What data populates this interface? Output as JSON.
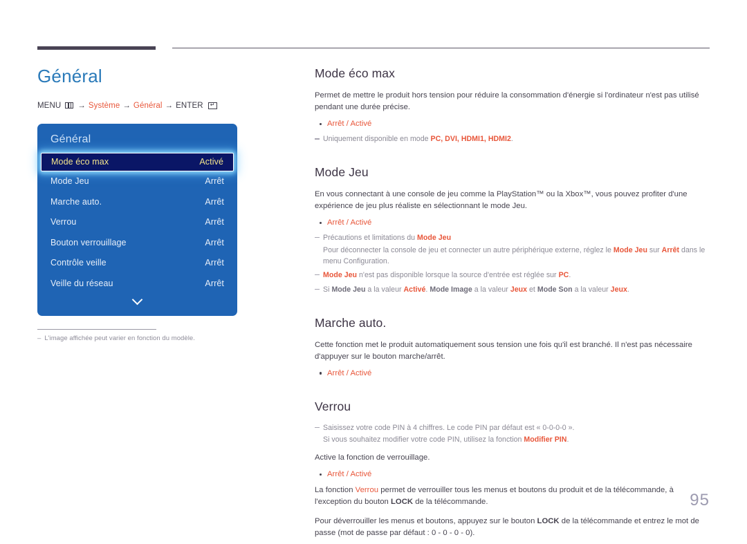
{
  "page": {
    "title": "Général",
    "number": "95",
    "accent_color": "#e8563a",
    "title_color": "#2a7ab9",
    "osd_color": "#1f64b4"
  },
  "breadcrumb": {
    "menu_label": "MENU",
    "menu_icon": "menu-grid-icon",
    "arrow": "→",
    "item1": "Système",
    "item2": "Général",
    "enter_label": "ENTER",
    "enter_icon": "enter-key-icon"
  },
  "osd": {
    "header": "Général",
    "more_icon": "chevron-down-icon",
    "rows": [
      {
        "label": "Mode éco max",
        "value": "Activé",
        "selected": true
      },
      {
        "label": "Mode Jeu",
        "value": "Arrêt",
        "selected": false
      },
      {
        "label": "Marche auto.",
        "value": "Arrêt",
        "selected": false
      },
      {
        "label": "Verrou",
        "value": "Arrêt",
        "selected": false
      },
      {
        "label": "Bouton verrouillage",
        "value": "Arrêt",
        "selected": false
      },
      {
        "label": "Contrôle veille",
        "value": "Arrêt",
        "selected": false
      },
      {
        "label": "Veille du réseau",
        "value": "Arrêt",
        "selected": false
      }
    ]
  },
  "left_note": {
    "dash": "–",
    "text": "L'image affichée peut varier en fonction du modèle."
  },
  "sections": {
    "eco": {
      "title": "Mode éco max",
      "para": "Permet de mettre le produit hors tension pour réduire la consommation d'énergie si l'ordinateur n'est pas utilisé pendant une durée précise.",
      "bullet_off": "Arrêt",
      "bullet_sep": " / ",
      "bullet_on": "Activé",
      "note_prefix": "Uniquement disponible en mode ",
      "note_modes": "PC, DVI, HDMI1, HDMI2",
      "note_suffix": "."
    },
    "jeu": {
      "title": "Mode Jeu",
      "para": "En vous connectant à une console de jeu comme la PlayStation™ ou la Xbox™, vous pouvez profiter d'une expérience de jeu plus réaliste en sélectionnant le mode Jeu.",
      "bullet_off": "Arrêt",
      "bullet_sep": " / ",
      "bullet_on": "Activé",
      "note1_a": "Précautions et limitations du ",
      "note1_b": "Mode Jeu",
      "note1_cont_a": "Pour déconnecter la console de jeu et connecter un autre périphérique externe, réglez le ",
      "note1_cont_b": "Mode Jeu",
      "note1_cont_c": " sur ",
      "note1_cont_d": "Arrêt",
      "note1_cont_e": " dans le menu Configuration.",
      "note2_a": "Mode Jeu",
      "note2_b": " n'est pas disponible lorsque la source d'entrée est réglée sur ",
      "note2_c": "PC",
      "note2_d": ".",
      "note3_a": "Si ",
      "note3_b": "Mode Jeu",
      "note3_c": " a la valeur ",
      "note3_d": "Activé",
      "note3_e": ". ",
      "note3_f": "Mode Image",
      "note3_g": " a la valeur ",
      "note3_h": "Jeux",
      "note3_i": " et ",
      "note3_j": "Mode Son",
      "note3_k": " a la valeur ",
      "note3_l": "Jeux",
      "note3_m": "."
    },
    "marche": {
      "title": "Marche auto.",
      "para": "Cette fonction met le produit automatiquement sous tension une fois qu'il est branché. Il n'est pas nécessaire d'appuyer sur le bouton marche/arrêt.",
      "bullet_off": "Arrêt",
      "bullet_sep": " / ",
      "bullet_on": "Activé"
    },
    "verrou": {
      "title": "Verrou",
      "note1_a": "Saisissez votre code PIN à 4 chiffres. Le code PIN par défaut est « 0-0-0-0 ».",
      "note1_cont_a": "Si vous souhaitez modifier votre code PIN, utilisez la fonction ",
      "note1_cont_b": "Modifier PIN",
      "note1_cont_c": ".",
      "para1": "Active la fonction de verrouillage.",
      "bullet_off": "Arrêt",
      "bullet_sep": " / ",
      "bullet_on": "Activé",
      "para2_a": "La fonction ",
      "para2_b": "Verrou",
      "para2_c": " permet de verrouiller tous les menus et boutons du produit et de la télécommande, à l'exception du bouton ",
      "para2_d": "LOCK",
      "para2_e": " de la télécommande.",
      "para3_a": "Pour déverrouiller les menus et boutons, appuyez sur le bouton ",
      "para3_b": "LOCK",
      "para3_c": " de la télécommande et entrez le mot de passe (mot de passe par défaut : 0 - 0 - 0 - 0)."
    }
  }
}
